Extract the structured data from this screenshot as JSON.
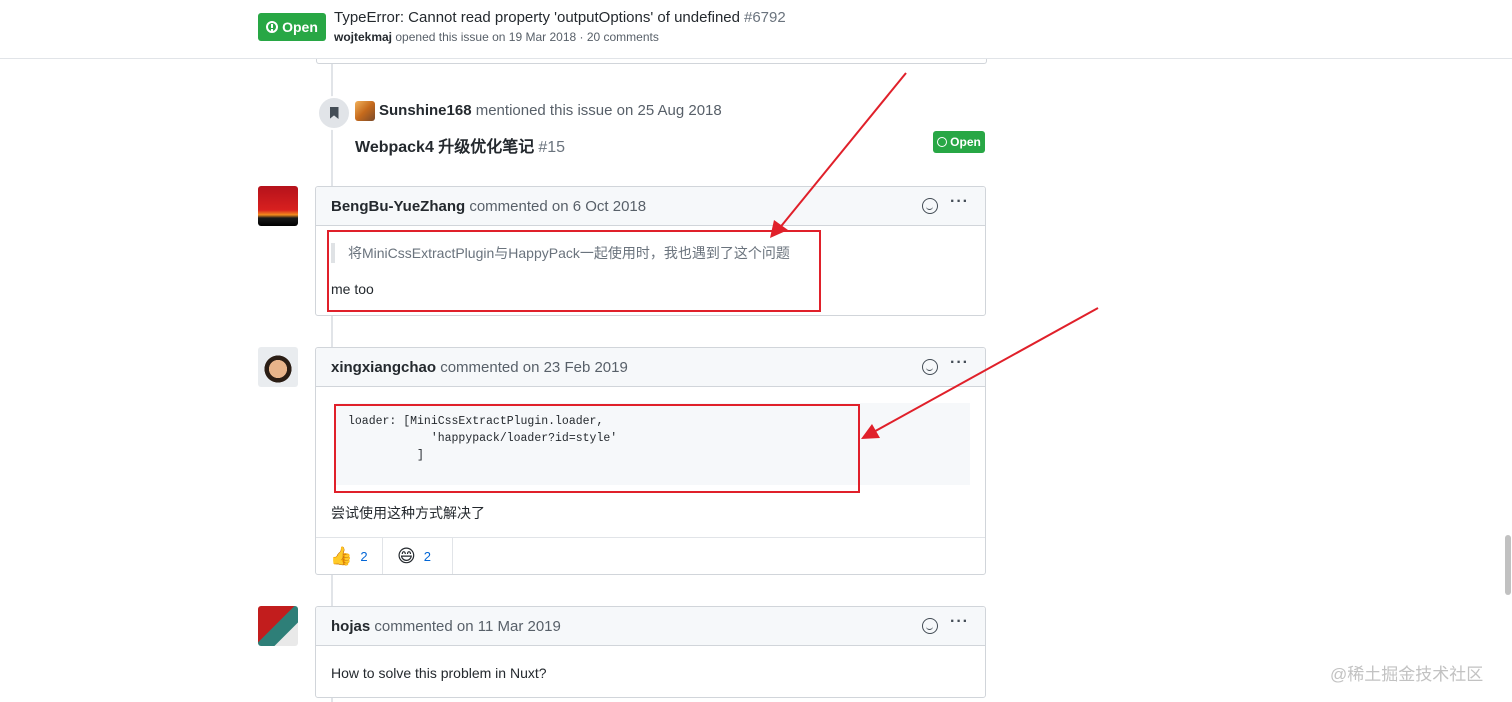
{
  "header": {
    "badge": "Open",
    "title": "TypeError: Cannot read property 'outputOptions' of undefined",
    "number": "#6792",
    "author": "wojtekmaj",
    "meta": "opened this issue on 19 Mar 2018 · 20 comments"
  },
  "mention_event": {
    "user": "Sunshine168",
    "text": "mentioned this issue on 25 Aug 2018",
    "ref_title": "Webpack4 升级优化笔记",
    "ref_number": "#15",
    "ref_badge": "Open"
  },
  "comments": [
    {
      "author": "BengBu-YueZhang",
      "meta": "commented on 6 Oct 2018",
      "quote": "将MiniCssExtractPlugin与HappyPack一起使用时，我也遇到了这个问题",
      "body": "me too"
    },
    {
      "author": "xingxiangchao",
      "meta": "commented on 23 Feb 2019",
      "code": "loader: [MiniCssExtractPlugin.loader,\n            'happypack/loader?id=style'\n          ]",
      "body": "尝试使用这种方式解决了",
      "reactions": [
        {
          "icon": "thumbs-up-icon",
          "emoji": "👍",
          "count": "2"
        },
        {
          "icon": "laugh-icon",
          "emoji": "😄",
          "count": "2"
        }
      ]
    },
    {
      "author": "hojas",
      "meta": "commented on 11 Mar 2019",
      "body": "How to solve this problem in Nuxt?"
    }
  ],
  "watermark": "@稀土掘金技术社区",
  "colors": {
    "open_green": "#28a745",
    "annotation_red": "#e0202a",
    "link_blue": "#0366d6"
  }
}
